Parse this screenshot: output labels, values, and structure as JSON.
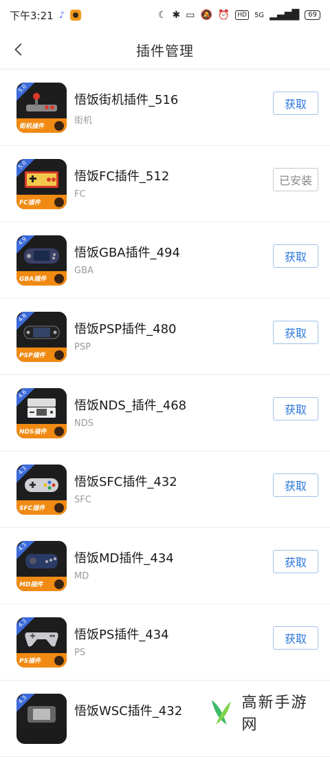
{
  "status_bar": {
    "time": "下午3:21",
    "hd_badge": "HD",
    "network": "5G",
    "battery": "69"
  },
  "header": {
    "title": "插件管理"
  },
  "plugins": [
    {
      "name": "悟饭街机插件_516",
      "platform": "街机",
      "version": "5.0",
      "tag": "街机插件",
      "button": "获取",
      "installed": false
    },
    {
      "name": "悟饭FC插件_512",
      "platform": "FC",
      "version": "5.0",
      "tag": "FC插件",
      "button": "已安装",
      "installed": true
    },
    {
      "name": "悟饭GBA插件_494",
      "platform": "GBA",
      "version": "4.9",
      "tag": "GBA插件",
      "button": "获取",
      "installed": false
    },
    {
      "name": "悟饭PSP插件_480",
      "platform": "PSP",
      "version": "4.8",
      "tag": "PSP插件",
      "button": "获取",
      "installed": false
    },
    {
      "name": "悟饭NDS_插件_468",
      "platform": "NDS",
      "version": "4.6",
      "tag": "NDS插件",
      "button": "获取",
      "installed": false
    },
    {
      "name": "悟饭SFC插件_432",
      "platform": "SFC",
      "version": "4.3",
      "tag": "SFC插件",
      "button": "获取",
      "installed": false
    },
    {
      "name": "悟饭MD插件_434",
      "platform": "MD",
      "version": "4.3",
      "tag": "MD插件",
      "button": "获取",
      "installed": false
    },
    {
      "name": "悟饭PS插件_434",
      "platform": "PS",
      "version": "4.3",
      "tag": "PS插件",
      "button": "获取",
      "installed": false
    },
    {
      "name": "悟饭WSC插件_432",
      "platform": "",
      "version": "4.3",
      "tag": "",
      "button": "",
      "installed": false
    }
  ],
  "watermark": {
    "text": "高新手游网"
  },
  "colors": {
    "accent": "#2b77d8",
    "icon_orange": "#f08a12",
    "version_blue": "#3c6bd9"
  }
}
